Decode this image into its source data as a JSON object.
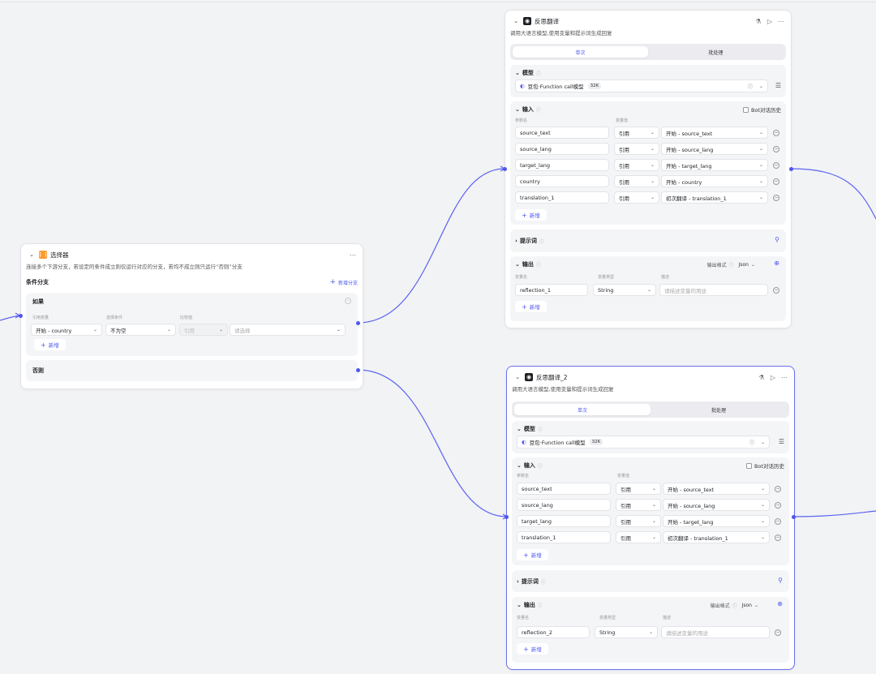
{
  "colors": {
    "accent": "#4e57f0",
    "edge": "#5b63f0",
    "border_selected": "#6b70f0"
  },
  "selector": {
    "title": "选择器",
    "icon": "branch-icon",
    "description": "连接多个下游分支，若设定的条件成立则仅运行对应的分支，若均不成立则只运行“否则”分支",
    "section_title": "条件分支",
    "add_branch": "新增分支",
    "if_label": "如果",
    "col_ref": "引用变量",
    "col_cond": "选择条件",
    "col_cmp": "比较值",
    "ref_value": "开始 - country",
    "cond_value": "不为空",
    "cmp_type": "引用",
    "cmp_placeholder": "请选择",
    "add_label": "新增",
    "else_label": "否则"
  },
  "reflect1": {
    "title": "反思翻译",
    "description": "调用大语言模型,使用变量和提示词生成回复",
    "tabs": [
      "单次",
      "批处理"
    ],
    "model_label": "模型",
    "model_name": "豆包·Function call模型",
    "model_tag": "32K",
    "input_label": "输入",
    "bot_history": "Bot对话历史",
    "col_param": "参数名",
    "col_value": "变量值",
    "inputs": [
      {
        "name": "source_text",
        "type": "引用",
        "value": "开始 - source_text"
      },
      {
        "name": "source_lang",
        "type": "引用",
        "value": "开始 - source_lang"
      },
      {
        "name": "target_lang",
        "type": "引用",
        "value": "开始 - target_lang"
      },
      {
        "name": "country",
        "type": "引用",
        "value": "开始 - country"
      },
      {
        "name": "translation_1",
        "type": "引用",
        "value": "初次翻译 - translation_1"
      }
    ],
    "add_label": "新增",
    "prompt_label": "提示词",
    "output_label": "输出",
    "output_format_label": "输出格式",
    "output_format": "Json",
    "col_var_name": "变量名",
    "col_var_type": "变量类型",
    "col_desc": "描述",
    "output_name": "reflection_1",
    "output_type": "String",
    "output_desc_placeholder": "请描述变量的用途"
  },
  "reflect2": {
    "title": "反思翻译_2",
    "description": "调用大语言模型,使用变量和提示词生成回复",
    "tabs": [
      "单次",
      "批处理"
    ],
    "model_label": "模型",
    "model_name": "豆包·Function call模型",
    "model_tag": "32K",
    "input_label": "输入",
    "bot_history": "Bot对话历史",
    "col_param": "参数名",
    "col_value": "变量值",
    "inputs": [
      {
        "name": "source_text",
        "type": "引用",
        "value": "开始 - source_text"
      },
      {
        "name": "source_lang",
        "type": "引用",
        "value": "开始 - source_lang"
      },
      {
        "name": "target_lang",
        "type": "引用",
        "value": "开始 - target_lang"
      },
      {
        "name": "translation_1",
        "type": "引用",
        "value": "初次翻译 - translation_1"
      }
    ],
    "add_label": "新增",
    "prompt_label": "提示词",
    "output_label": "输出",
    "output_format_label": "输出格式",
    "output_format": "Json",
    "col_var_name": "变量名",
    "col_var_type": "变量类型",
    "col_desc": "描述",
    "output_name": "reflection_2",
    "output_type": "String",
    "output_desc_placeholder": "请描述变量的用途"
  }
}
